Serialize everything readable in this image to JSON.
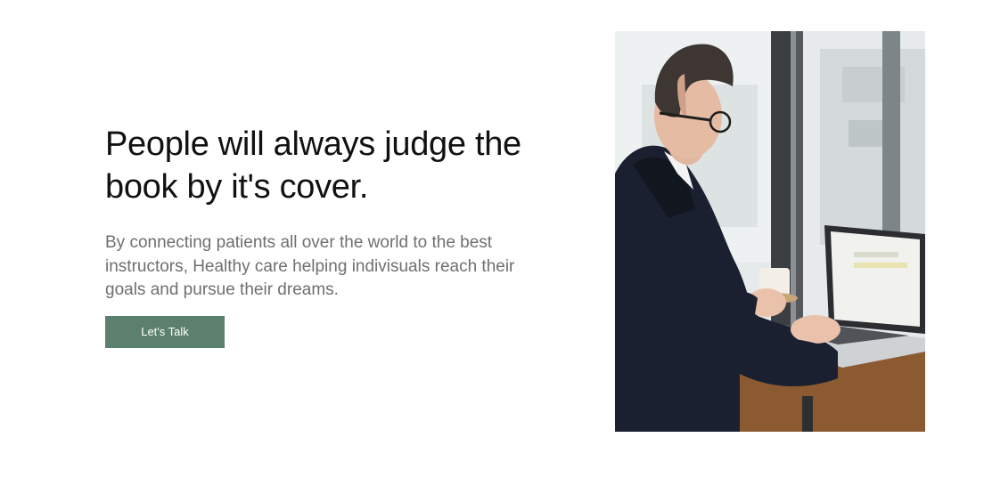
{
  "hero": {
    "headline": "People will always judge the book by it's cover.",
    "description": "By connecting patients all over the world to the best instructors, Healthy care helping indivisuals reach their goals and pursue their dreams.",
    "cta_label": "Let's Talk"
  },
  "image": {
    "subject": "man-with-glasses-working-on-laptop-at-cafe-window"
  },
  "colors": {
    "accent": "#5b806d",
    "headline": "#111111",
    "body_text": "#6f6f6f",
    "background": "#ffffff"
  }
}
